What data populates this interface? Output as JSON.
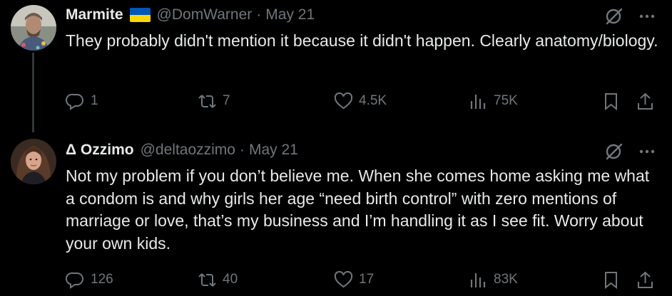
{
  "tweets": [
    {
      "author": {
        "name": "Marmite",
        "handle": "@DomWarner",
        "date": "May 21",
        "flag": "ukraine-flag"
      },
      "text": "They probably didn't mention it because it didn't happen. Clearly anatomy/biology.",
      "stats": {
        "replies": "1",
        "retweets": "7",
        "likes": "4.5K",
        "views": "75K"
      }
    },
    {
      "author": {
        "name": "Δ Ozzimo",
        "handle": "@deltaozzimo",
        "date": "May 21"
      },
      "text": "Not my problem if you don’t believe me. When she comes home asking me what a condom is and why girls her age “need birth control” with zero mentions of marriage or love, that’s my business and I’m handling it as I see fit. Worry about your own kids.",
      "stats": {
        "replies": "126",
        "retweets": "40",
        "likes": "17",
        "views": "83K"
      }
    }
  ],
  "separator": "·",
  "colors": {
    "background": "#000000",
    "text": "#e7e9ea",
    "muted": "#71767b",
    "thread_line": "#333639"
  }
}
